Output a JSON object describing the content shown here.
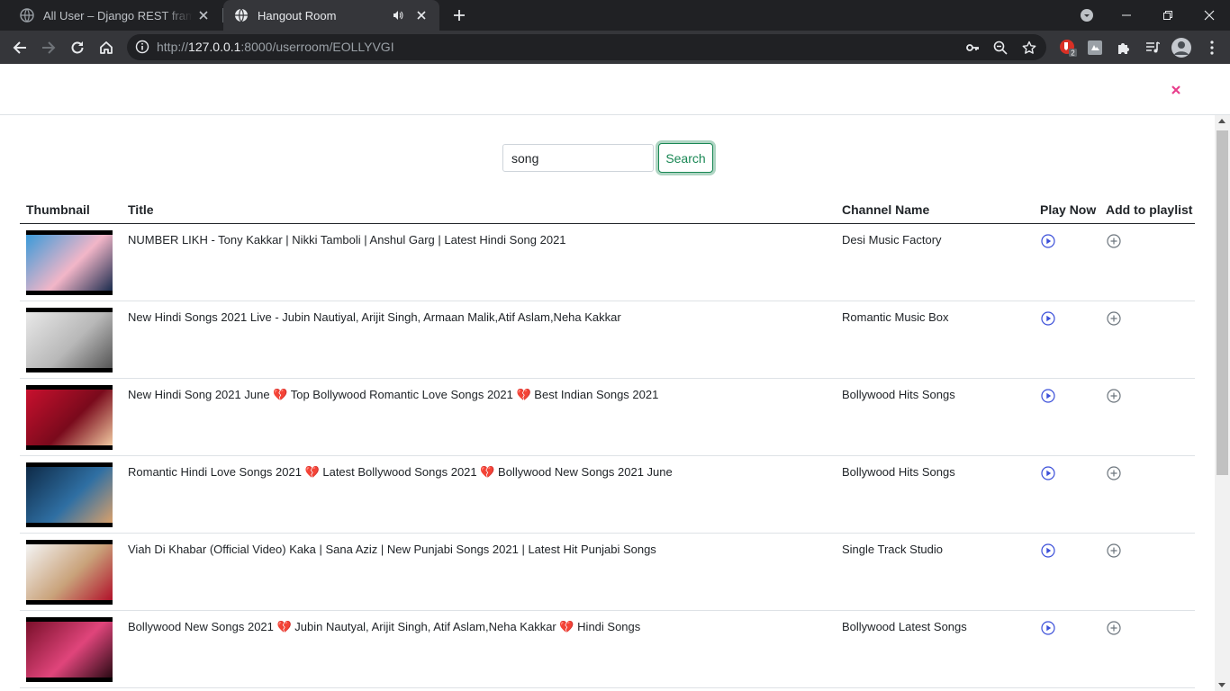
{
  "browser": {
    "tabs": [
      {
        "title": "All User – Django REST framework",
        "active": false
      },
      {
        "title": "Hangout Room",
        "active": true
      }
    ],
    "url": {
      "scheme": "http://",
      "host": "127.0.0.1",
      "rest": ":8000/userroom/EOLLYVGI"
    },
    "extension_badge": "2"
  },
  "search": {
    "value": "song",
    "button_label": "Search"
  },
  "table": {
    "headers": {
      "thumbnail": "Thumbnail",
      "title": "Title",
      "channel": "Channel Name",
      "play": "Play Now",
      "add": "Add to playlist"
    },
    "rows": [
      {
        "title": "NUMBER LIKH - Tony Kakkar | Nikki Tamboli | Anshul Garg | Latest Hindi Song 2021",
        "channel": "Desi Music Factory",
        "thumb_colors": [
          "#3a9ad9",
          "#f2b6c8",
          "#1b2c4e"
        ]
      },
      {
        "title": "New Hindi Songs 2021 Live - Jubin Nautiyal, Arijit Singh, Armaan Malik,Atif Aslam,Neha Kakkar",
        "channel": "Romantic Music Box",
        "thumb_colors": [
          "#e8e8e8",
          "#b8b8b8",
          "#555555"
        ]
      },
      {
        "title": "New Hindi Song 2021 June 💔 Top Bollywood Romantic Love Songs 2021 💔 Best Indian Songs 2021",
        "channel": "Bollywood Hits Songs",
        "thumb_colors": [
          "#c8102e",
          "#7a0a1c",
          "#f0c8a0"
        ]
      },
      {
        "title": "Romantic Hindi Love Songs 2021 💔 Latest Bollywood Songs 2021 💔 Bollywood New Songs 2021 June",
        "channel": "Bollywood Hits Songs",
        "thumb_colors": [
          "#0e2a47",
          "#2f6fa3",
          "#d9a06b"
        ]
      },
      {
        "title": "Viah Di Khabar (Official Video) Kaka | Sana Aziz | New Punjabi Songs 2021 | Latest Hit Punjabi Songs",
        "channel": "Single Track Studio",
        "thumb_colors": [
          "#f4f4f4",
          "#c9a27a",
          "#b1122a"
        ]
      },
      {
        "title": "Bollywood New Songs 2021 💔 Jubin Nautyal, Arijit Singh, Atif Aslam,Neha Kakkar 💔 Hindi Songs",
        "channel": "Bollywood Latest Songs",
        "thumb_colors": [
          "#7a0f2a",
          "#e0457b",
          "#2a0a14"
        ]
      }
    ]
  }
}
